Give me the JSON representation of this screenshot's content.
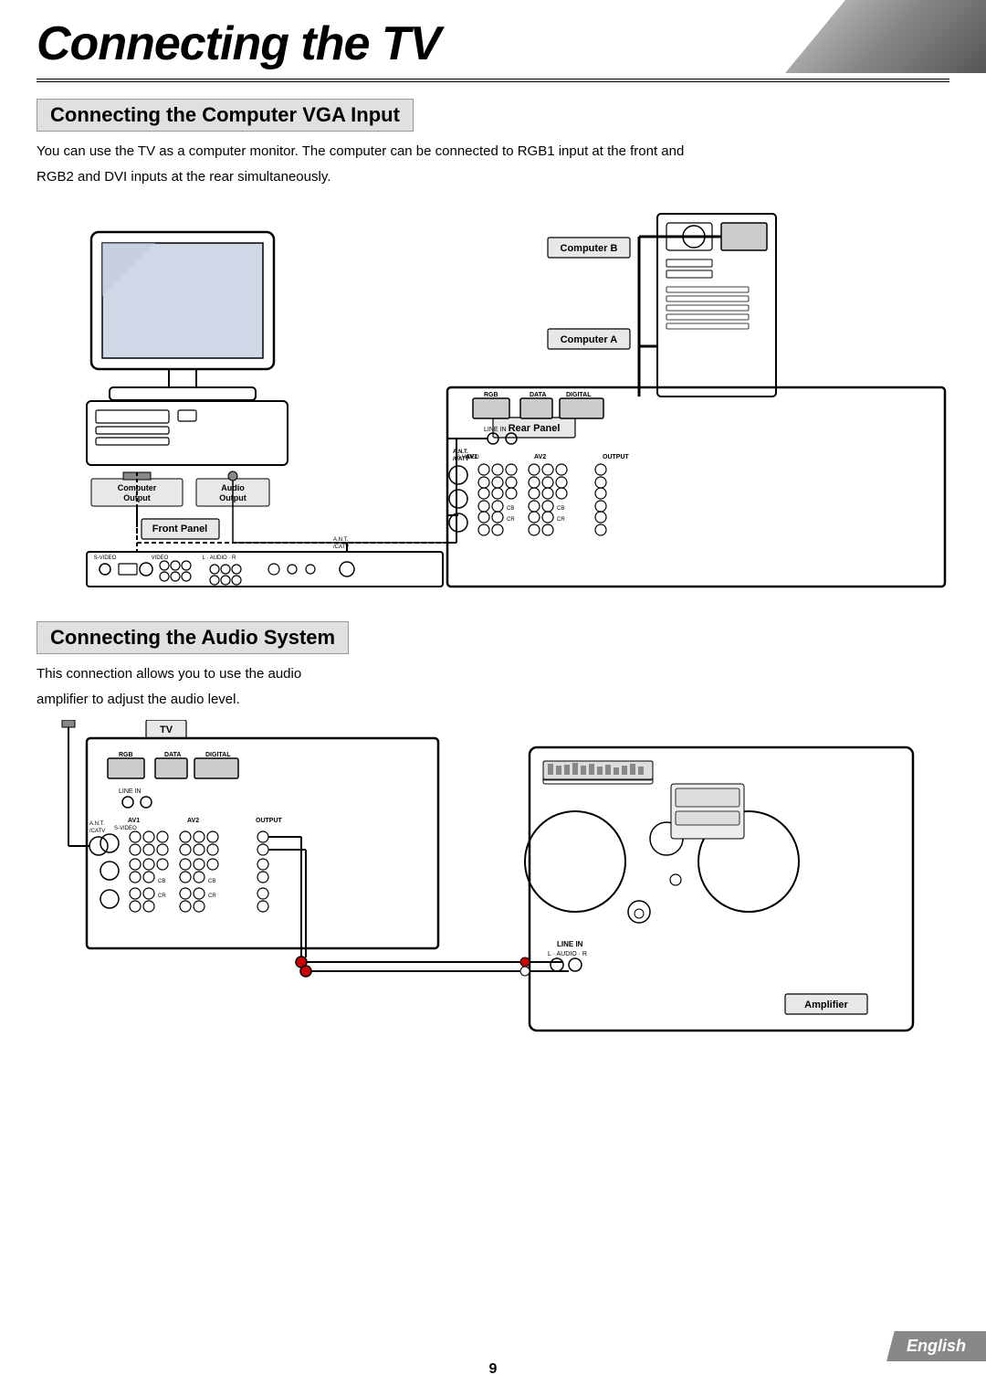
{
  "page": {
    "title": "Connecting the TV",
    "page_number": "9",
    "language_badge": "English"
  },
  "section1": {
    "header": "Connecting the Computer VGA Input",
    "body1": "You can use the TV as a computer monitor. The computer can be connected to RGB1 input at the front and",
    "body2": "RGB2 and DVI inputs at the rear simultaneously.",
    "labels": {
      "computer_b": "Computer B",
      "computer_a": "Computer A",
      "rear_panel": "Rear Panel",
      "front_panel": "Front Panel",
      "computer_output": "Computer Output",
      "audio_output": "Audio Output"
    }
  },
  "section2": {
    "header": "Connecting the Audio System",
    "body1": "This connection allows you to use the audio",
    "body2": "amplifier to adjust the audio level.",
    "labels": {
      "tv": "TV",
      "amplifier": "Amplifier"
    }
  }
}
